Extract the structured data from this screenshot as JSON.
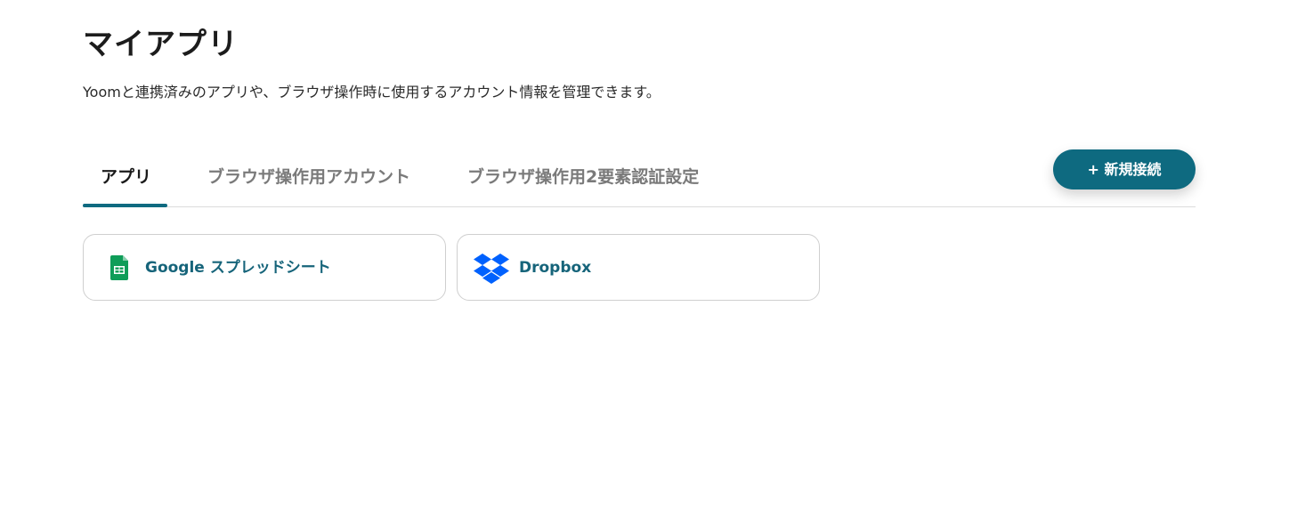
{
  "page": {
    "title": "マイアプリ",
    "subtitle": "Yoomと連携済みのアプリや、ブラウザ操作時に使用するアカウント情報を管理できます。"
  },
  "tabs": [
    {
      "label": "アプリ",
      "active": true
    },
    {
      "label": "ブラウザ操作用アカウント",
      "active": false
    },
    {
      "label": "ブラウザ操作用2要素認証設定",
      "active": false
    }
  ],
  "actions": {
    "new_connection_label": "+ 新規接続"
  },
  "apps": [
    {
      "label": "Google スプレッドシート",
      "icon": "google-sheets-icon"
    },
    {
      "label": "Dropbox",
      "icon": "dropbox-icon"
    }
  ],
  "colors": {
    "accent": "#0e6a80",
    "app_label": "#16647a",
    "sheets_green": "#0f9d58",
    "dropbox_blue": "#0061fe"
  }
}
